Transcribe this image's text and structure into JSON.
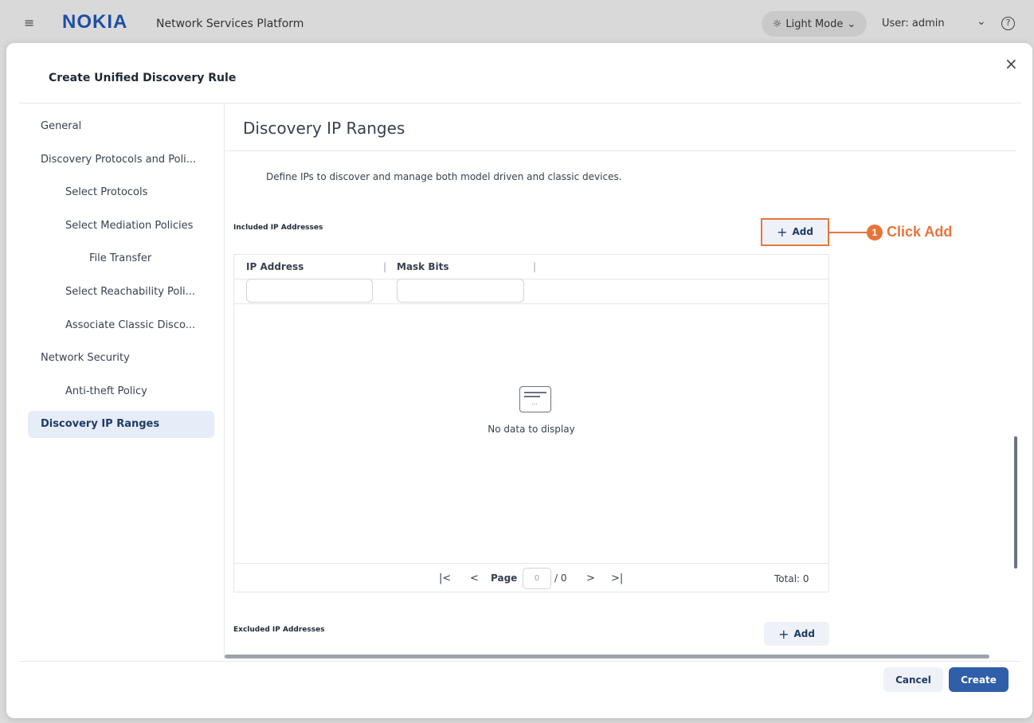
{
  "topbar": {
    "brand": "NOKIA",
    "app_title": "Network Services Platform",
    "mode_label": "Light Mode",
    "user_label": "User: admin"
  },
  "dialog": {
    "title": "Create Unified Discovery Rule"
  },
  "sidebar": {
    "items": [
      {
        "label": "General"
      },
      {
        "label": "Discovery Protocols and Poli..."
      },
      {
        "label": "Select Protocols"
      },
      {
        "label": "Select Mediation Policies"
      },
      {
        "label": "File Transfer"
      },
      {
        "label": "Select Reachability Poli..."
      },
      {
        "label": "Associate Classic Disco..."
      },
      {
        "label": "Network Security"
      },
      {
        "label": "Anti-theft Policy"
      },
      {
        "label": "Discovery IP Ranges"
      }
    ]
  },
  "main": {
    "section_title": "Discovery IP Ranges",
    "description": "Define IPs to discover and manage both model driven and classic devices.",
    "included": {
      "label": "Included IP Addresses",
      "add_label": "Add",
      "columns": [
        "IP Address",
        "Mask Bits"
      ],
      "empty_text": "No data to display",
      "page_label": "Page",
      "page_value": "0",
      "page_total": "/ 0",
      "total_text": "Total: 0"
    },
    "excluded": {
      "label": "Excluded IP Addresses",
      "add_label": "Add"
    }
  },
  "callout": {
    "number": "1",
    "text": "Click Add",
    "color": "#e8743b"
  },
  "footer": {
    "cancel_label": "Cancel",
    "create_label": "Create"
  },
  "colors": {
    "accent": "#2f5fa8",
    "brand": "#1f4ea3"
  }
}
